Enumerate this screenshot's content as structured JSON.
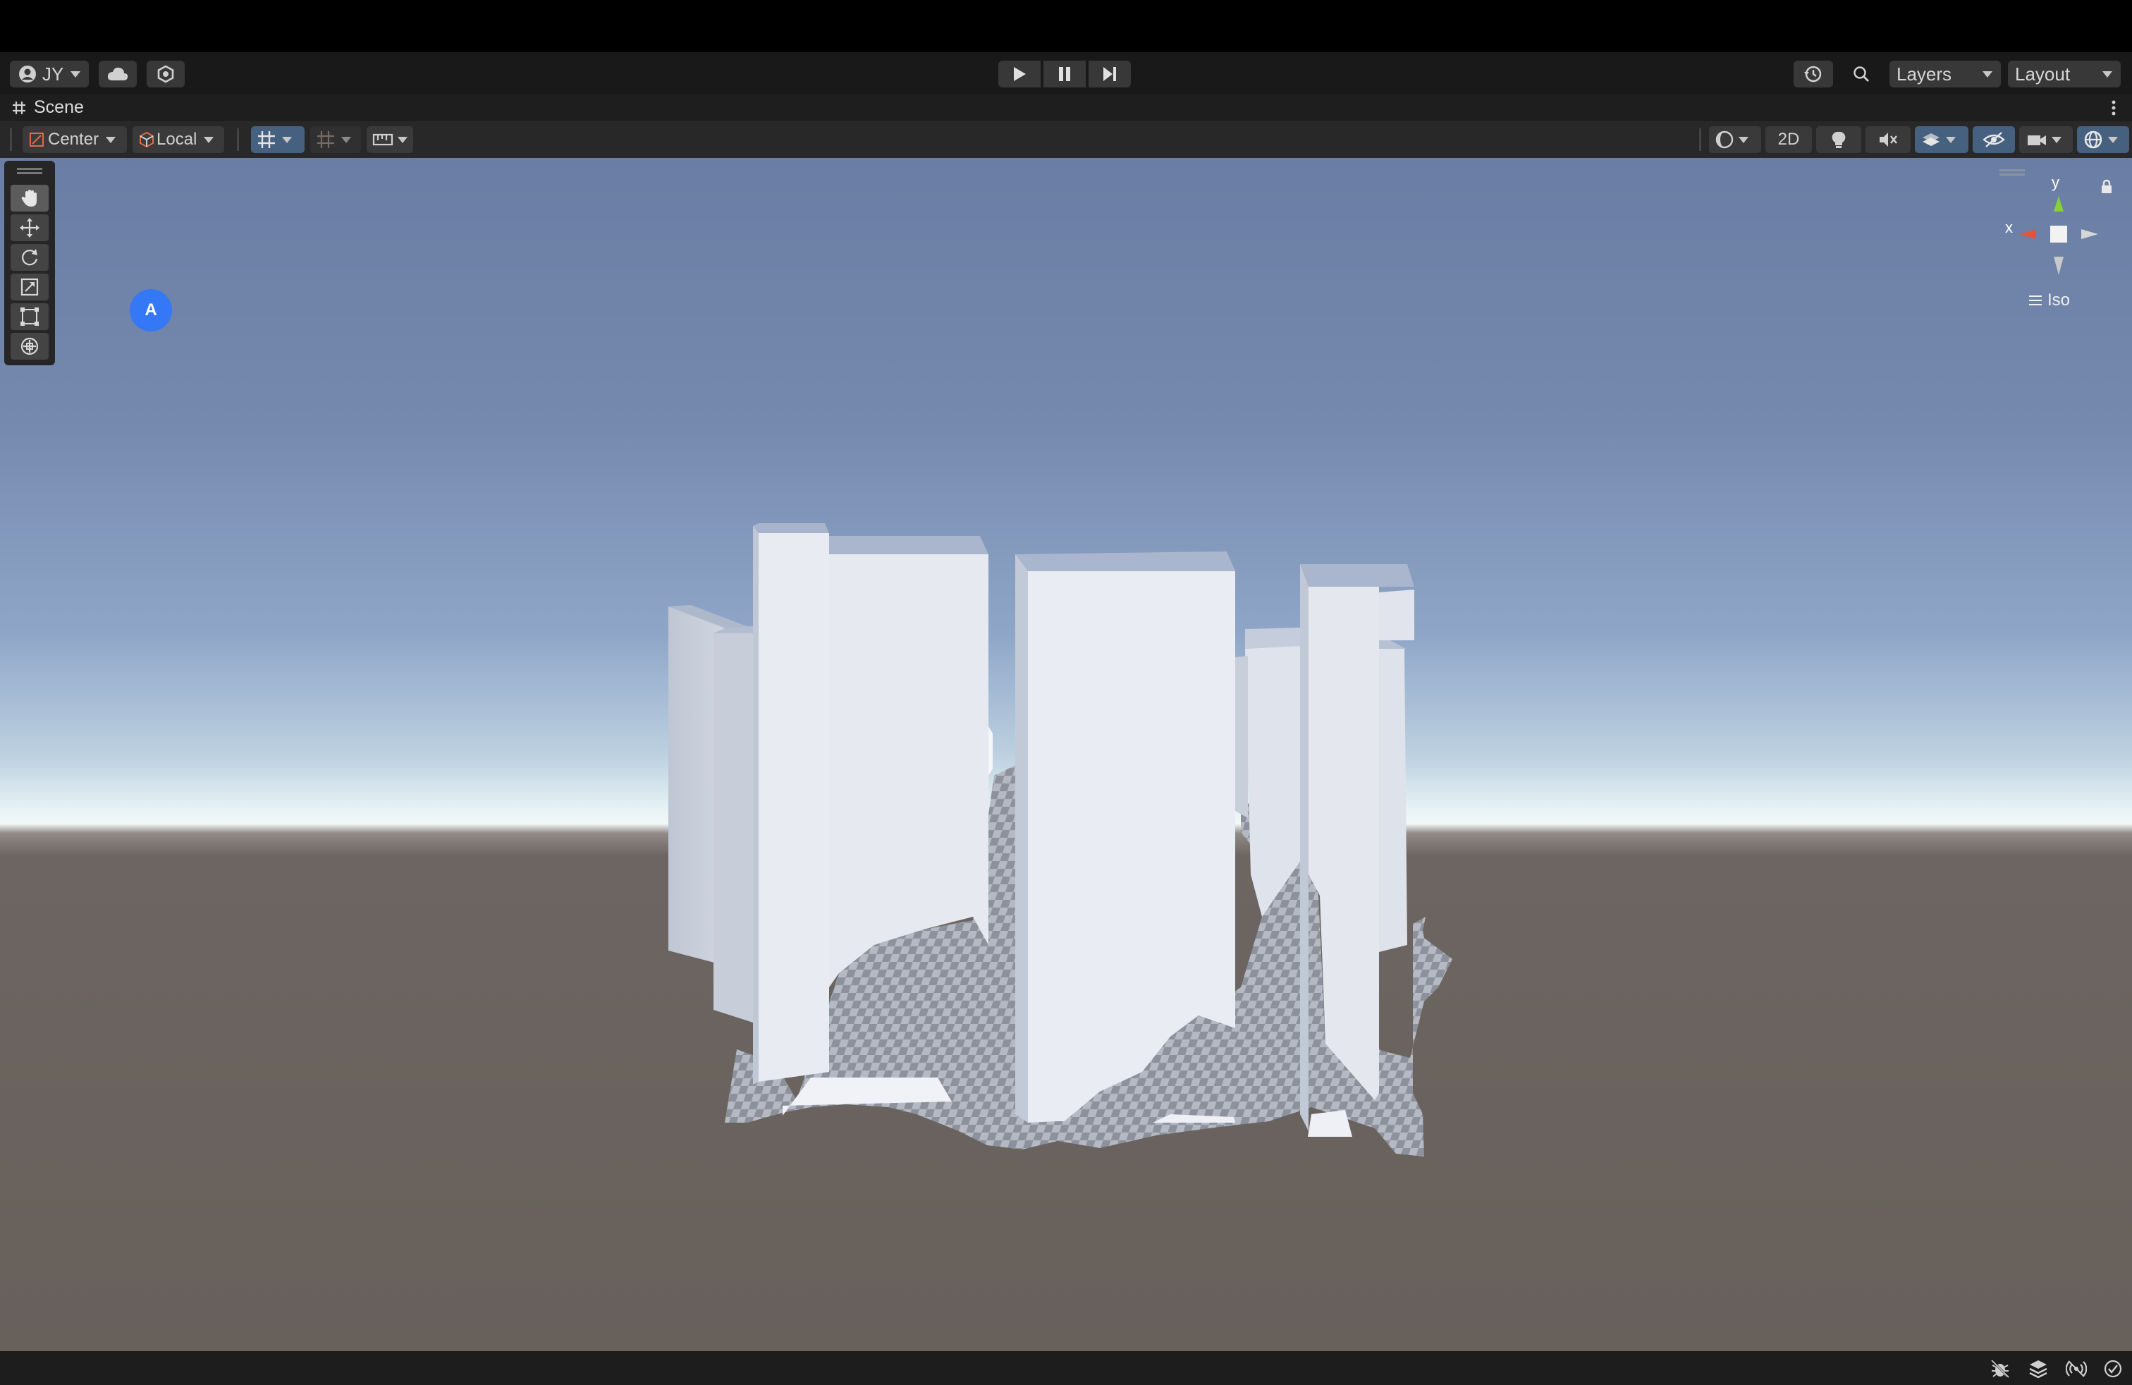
{
  "toolbar": {
    "account_label": "JY",
    "layers_label": "Layers",
    "layout_label": "Layout"
  },
  "scene_tab": {
    "label": "Scene"
  },
  "scene_toolbar": {
    "pivot_label": "Center",
    "space_label": "Local",
    "mode_2d_label": "2D"
  },
  "viewport": {
    "avatar_letter": "A",
    "gizmo": {
      "y_label": "y",
      "x_label": "x",
      "projection_label": "Iso"
    }
  },
  "colors": {
    "toolbar_bg": "#191919",
    "accent_active": "#46607f",
    "avatar_blue": "#3478f6",
    "axis_x": "#e2553a",
    "axis_y": "#86d13a"
  },
  "icons": {
    "tools": [
      "hand-icon",
      "move-icon",
      "rotate-icon",
      "scale-icon",
      "rect-icon",
      "transform-icon"
    ],
    "status": [
      "bug-icon",
      "layers-stack-icon",
      "wireless-icon",
      "check-circle-icon"
    ]
  }
}
